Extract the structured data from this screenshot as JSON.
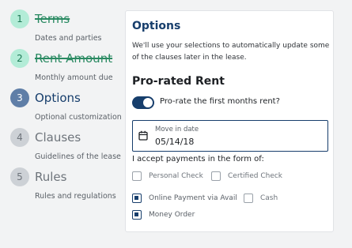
{
  "steps": [
    {
      "number": "1",
      "title": "Terms",
      "subtitle": "Dates and parties",
      "state": "done"
    },
    {
      "number": "2",
      "title": "Rent Amount",
      "subtitle": "Monthly amount due",
      "state": "done"
    },
    {
      "number": "3",
      "title": "Options",
      "subtitle": "Optional customization",
      "state": "active"
    },
    {
      "number": "4",
      "title": "Clauses",
      "subtitle": "Guidelines of the lease",
      "state": "todo"
    },
    {
      "number": "5",
      "title": "Rules",
      "subtitle": "Rules and regulations",
      "state": "todo"
    }
  ],
  "card": {
    "title": "Options",
    "description": "We'll use your selections to automatically update some of the clauses later in the lease.",
    "prorated": {
      "heading": "Pro-rated Rent",
      "toggle_label": "Pro-rate the first months rent?",
      "toggle_on": true
    },
    "move_in": {
      "label": "Move in date",
      "value": "05/14/18",
      "icon": "calendar-icon"
    },
    "payments": {
      "label": "I accept payments in the form of:",
      "options": [
        {
          "label": "Personal Check",
          "checked": false
        },
        {
          "label": "Certified Check",
          "checked": false
        },
        {
          "label": "Online Payment via Avail",
          "checked": true
        },
        {
          "label": "Cash",
          "checked": false
        },
        {
          "label": "Money Order",
          "checked": true
        }
      ]
    }
  },
  "colors": {
    "primary": "#173e6c",
    "done_green": "#2a8a62",
    "done_badge": "#b3ecd7",
    "background": "#f2f3f4"
  }
}
